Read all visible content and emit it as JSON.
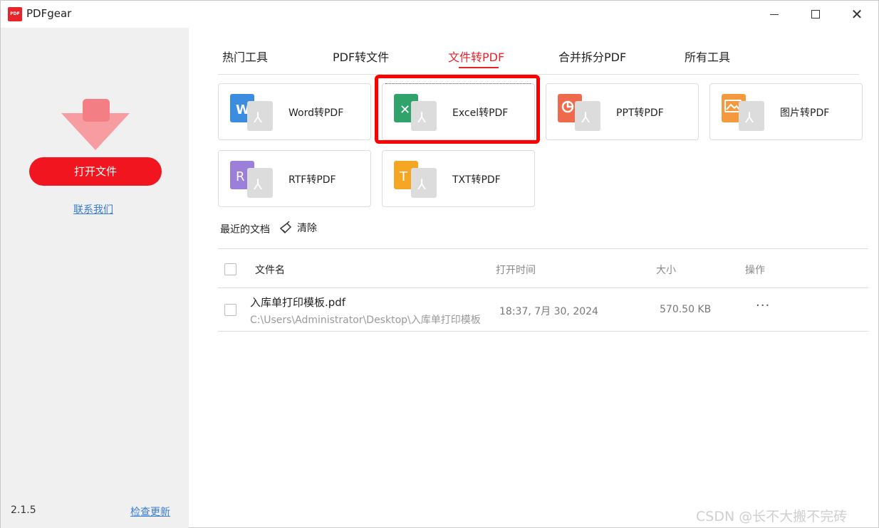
{
  "window": {
    "title": "PDFgear",
    "logo_text": "PDF"
  },
  "sidebar": {
    "open_file_label": "打开文件",
    "contact_label": "联系我们",
    "version": "2.1.5",
    "check_update_label": "检查更新"
  },
  "tabs": [
    {
      "label": "热门工具"
    },
    {
      "label": "PDF转文件"
    },
    {
      "label": "文件转PDF",
      "active": true
    },
    {
      "label": "合并拆分PDF"
    },
    {
      "label": "所有工具"
    }
  ],
  "tools": [
    {
      "label": "Word转PDF",
      "icon": "word-icon",
      "color": "#3b8de0",
      "letter": "W"
    },
    {
      "label": "Excel转PDF",
      "icon": "excel-icon",
      "color": "#2fa36b",
      "letter": "✕"
    },
    {
      "label": "PPT转PDF",
      "icon": "ppt-icon",
      "color": "#ef6a4c",
      "letter": "◔"
    },
    {
      "label": "图片转PDF",
      "icon": "image-icon",
      "color": "#f59a3c",
      "letter": "∿"
    },
    {
      "label": "RTF转PDF",
      "icon": "rtf-icon",
      "color": "#9b7fd8",
      "letter": "R"
    },
    {
      "label": "TXT转PDF",
      "icon": "txt-icon",
      "color": "#f5a623",
      "letter": "T"
    }
  ],
  "recent": {
    "title": "最近的文档",
    "clear_label": "清除",
    "columns": {
      "name": "文件名",
      "time": "打开时间",
      "size": "大小",
      "action": "操作"
    },
    "rows": [
      {
        "name": "入库单打印模板.pdf",
        "path": "C:\\Users\\Administrator\\Desktop\\入库单打印模板",
        "time": "18:37, 7月 30, 2024",
        "size": "570.50 KB",
        "more": "···"
      }
    ]
  },
  "watermark": "CSDN @长不大搬不完砖",
  "colors": {
    "accent": "#e8242b",
    "button": "#f0151f",
    "link": "#3a7bd5",
    "highlight": "#ff0000"
  }
}
